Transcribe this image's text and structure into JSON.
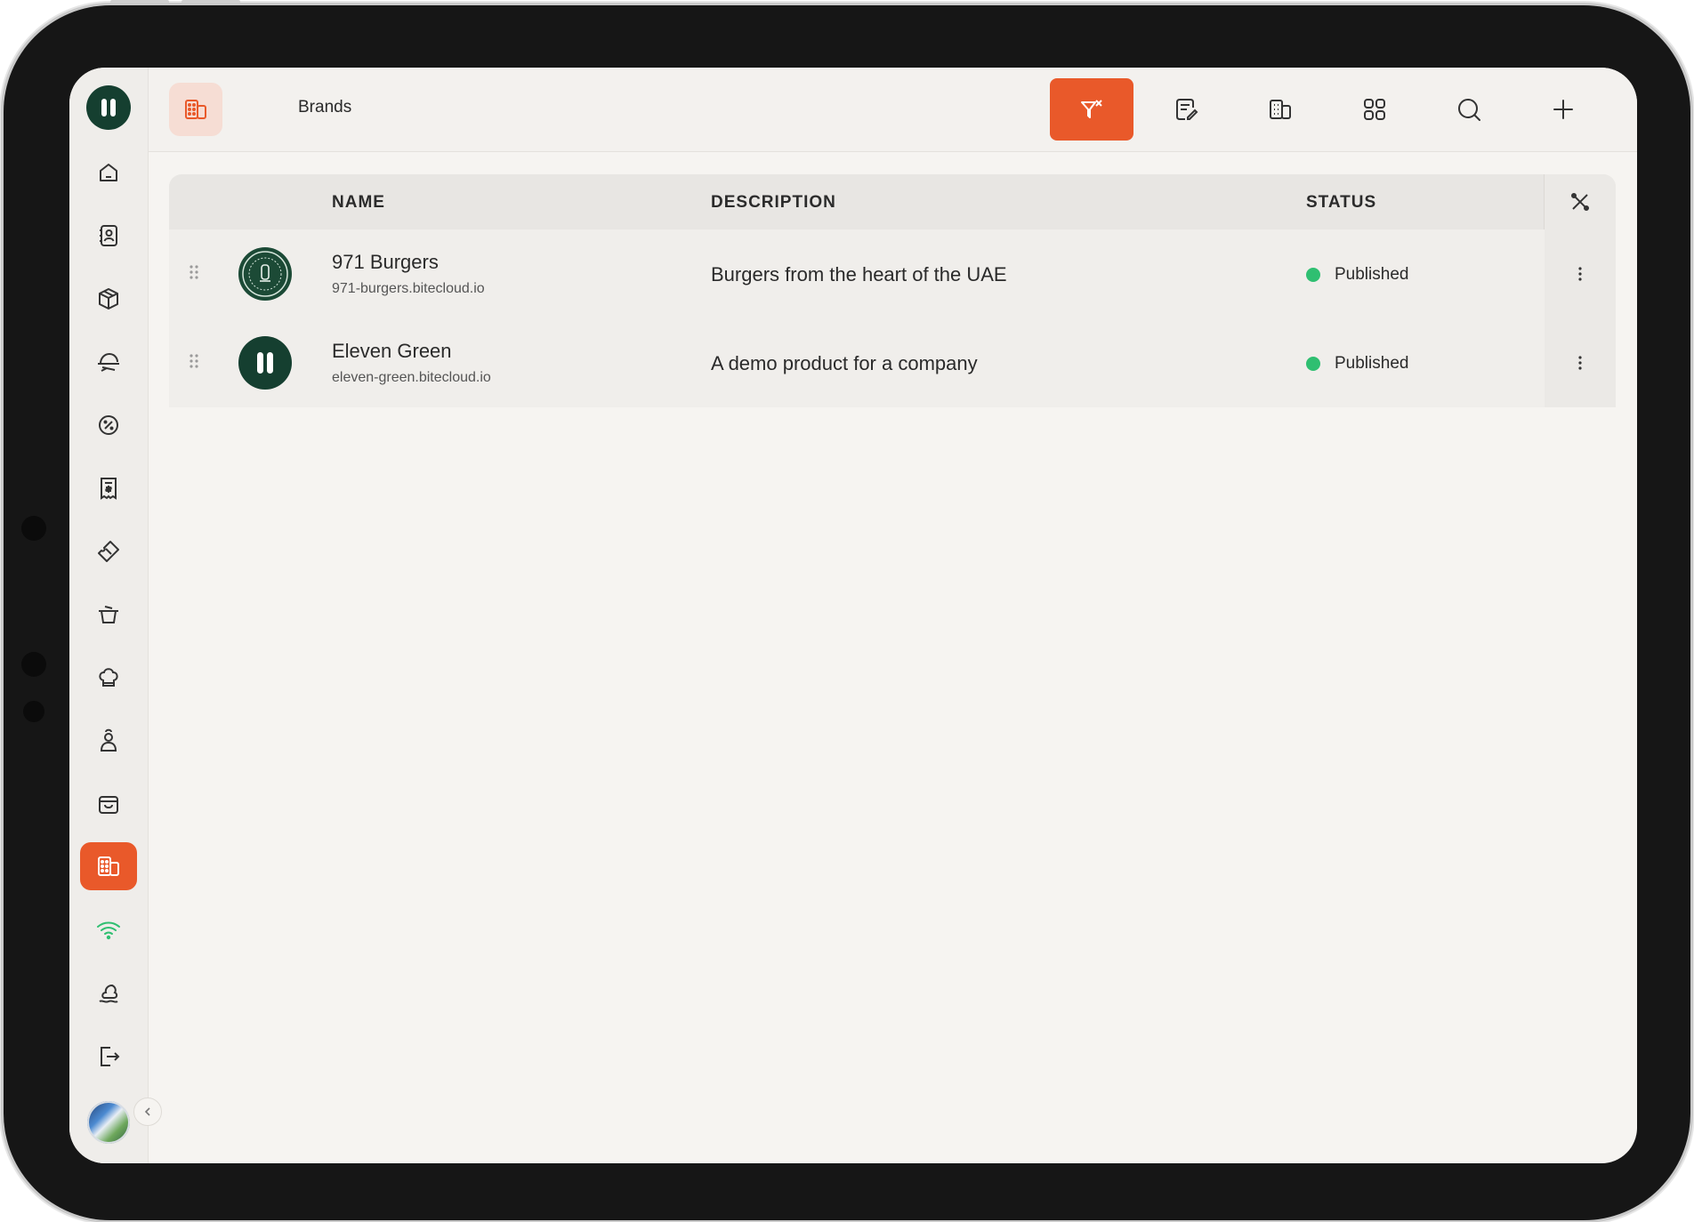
{
  "header": {
    "title": "Brands",
    "icon": "brands-building-icon",
    "actions": [
      {
        "name": "clear-filter",
        "icon": "filter-x-icon",
        "active": true
      },
      {
        "name": "notes",
        "icon": "note-edit-icon"
      },
      {
        "name": "buildings",
        "icon": "building-icon"
      },
      {
        "name": "grid-view",
        "icon": "grid-icon"
      },
      {
        "name": "search",
        "icon": "search-icon"
      },
      {
        "name": "add",
        "icon": "plus-icon"
      }
    ]
  },
  "sidebar": {
    "items": [
      {
        "icon": "home-icon"
      },
      {
        "icon": "contacts-icon"
      },
      {
        "icon": "box-icon"
      },
      {
        "icon": "delivery-icon"
      },
      {
        "icon": "discount-icon"
      },
      {
        "icon": "receipt-icon"
      },
      {
        "icon": "coupon-icon"
      },
      {
        "icon": "pot-icon"
      },
      {
        "icon": "chef-hat-icon"
      },
      {
        "icon": "chef-icon"
      },
      {
        "icon": "store-icon"
      },
      {
        "icon": "brands-building-icon",
        "active": true
      },
      {
        "icon": "wifi-icon"
      },
      {
        "icon": "weather-icon"
      },
      {
        "icon": "logout-icon"
      }
    ]
  },
  "table": {
    "columns": {
      "name": "NAME",
      "description": "DESCRIPTION",
      "status": "STATUS"
    },
    "rows": [
      {
        "name": "971 Burgers",
        "url": "971-burgers.bitecloud.io",
        "description": "Burgers from the heart of the UAE",
        "status": "Published"
      },
      {
        "name": "Eleven Green",
        "url": "eleven-green.bitecloud.io",
        "description": "A demo product for a company",
        "status": "Published"
      }
    ]
  },
  "colors": {
    "accent": "#e9592a",
    "brand_green": "#153f30",
    "status_published": "#2fbf71",
    "background": "#f6f4f1"
  }
}
